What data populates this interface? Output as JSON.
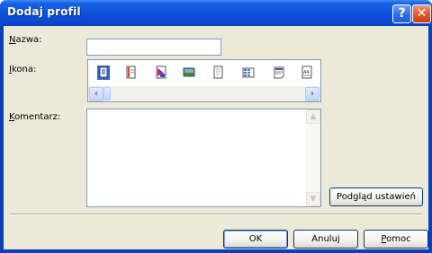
{
  "window": {
    "title": "Dodaj profil"
  },
  "titlebar_buttons": {
    "help": "?",
    "close": "✕"
  },
  "form": {
    "name_label": {
      "hot": "N",
      "rest": "azwa:"
    },
    "name_value": "",
    "icon_label": {
      "hot": "I",
      "rest": "kona:"
    },
    "comment_label": {
      "hot": "K",
      "rest": "omentarz:"
    },
    "comment_value": ""
  },
  "icons": [
    "document-icon-selected",
    "page-icon",
    "photo-print-icon",
    "image-icon",
    "blank-page-icon",
    "grid-layout-icon",
    "text-page-icon",
    "a4-page-icon"
  ],
  "buttons": {
    "preview": "Podgląd ustawień",
    "ok": "OK",
    "cancel": "Anuluj",
    "help": {
      "hot": "P",
      "rest": "omoc"
    }
  },
  "colors": {
    "title_bar": "#0b52d9",
    "dialog_face": "#ece9d8",
    "selection": "#3169c6"
  }
}
